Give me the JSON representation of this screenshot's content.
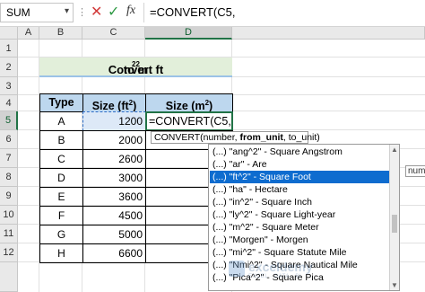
{
  "formula_bar": {
    "name_box": "SUM",
    "name_box_arrow": "▾",
    "separator": "⋮",
    "cancel_icon": "✕",
    "enter_icon": "✓",
    "fx_label": "fx",
    "formula": "=CONVERT(C5,"
  },
  "columns": [
    "A",
    "B",
    "C",
    "D"
  ],
  "rows": [
    "1",
    "2",
    "3",
    "4",
    "5",
    "6",
    "7",
    "8",
    "9",
    "10",
    "11",
    "12"
  ],
  "title": {
    "text_main": "Convert ft",
    "sup1": "2",
    "text_mid": " to m",
    "sup2": "2"
  },
  "table": {
    "headers": {
      "type": "Type",
      "size_ft": "Size (ft",
      "size_ft_sup": "2",
      "size_ft_close": ")",
      "size_m": "Size (m",
      "size_m_sup": "2",
      "size_m_close": ")"
    },
    "rows": [
      {
        "type": "A",
        "size": "1200",
        "result": "=CONVERT(C5,"
      },
      {
        "type": "B",
        "size": "2000",
        "result": ""
      },
      {
        "type": "C",
        "size": "2600",
        "result": ""
      },
      {
        "type": "D",
        "size": "3000",
        "result": ""
      },
      {
        "type": "E",
        "size": "3600",
        "result": ""
      },
      {
        "type": "F",
        "size": "4500",
        "result": ""
      },
      {
        "type": "G",
        "size": "5000",
        "result": ""
      },
      {
        "type": "H",
        "size": "6600",
        "result": ""
      }
    ]
  },
  "tooltip": {
    "prefix": "CONVERT(number, ",
    "bold_arg": "from_unit",
    "suffix": ", to_unit)"
  },
  "dropdown": {
    "items": [
      "(...) \"ang^2\" - Square Angstrom",
      "(...) \"ar\" - Are",
      "(...) \"ft^2\" - Square Foot",
      "(...) \"ha\" - Hectare",
      "(...) \"in^2\" - Square Inch",
      "(...) \"ly^2\" - Square Light-year",
      "(...) \"m^2\" - Square Meter",
      "(...) \"Morgen\" - Morgen",
      "(...) \"mi^2\" - Square Statute Mile",
      "(...) \"Nmi^2\" - Square Nautical Mile",
      "(...) \"Pica^2\" - Square Pica"
    ],
    "selected_index": 2,
    "scroll_up": "▲",
    "scroll_down": "▼"
  },
  "side_tip": "num",
  "watermark": {
    "name": "exceldemy",
    "sub": "EXCEL · DATA · BI"
  }
}
